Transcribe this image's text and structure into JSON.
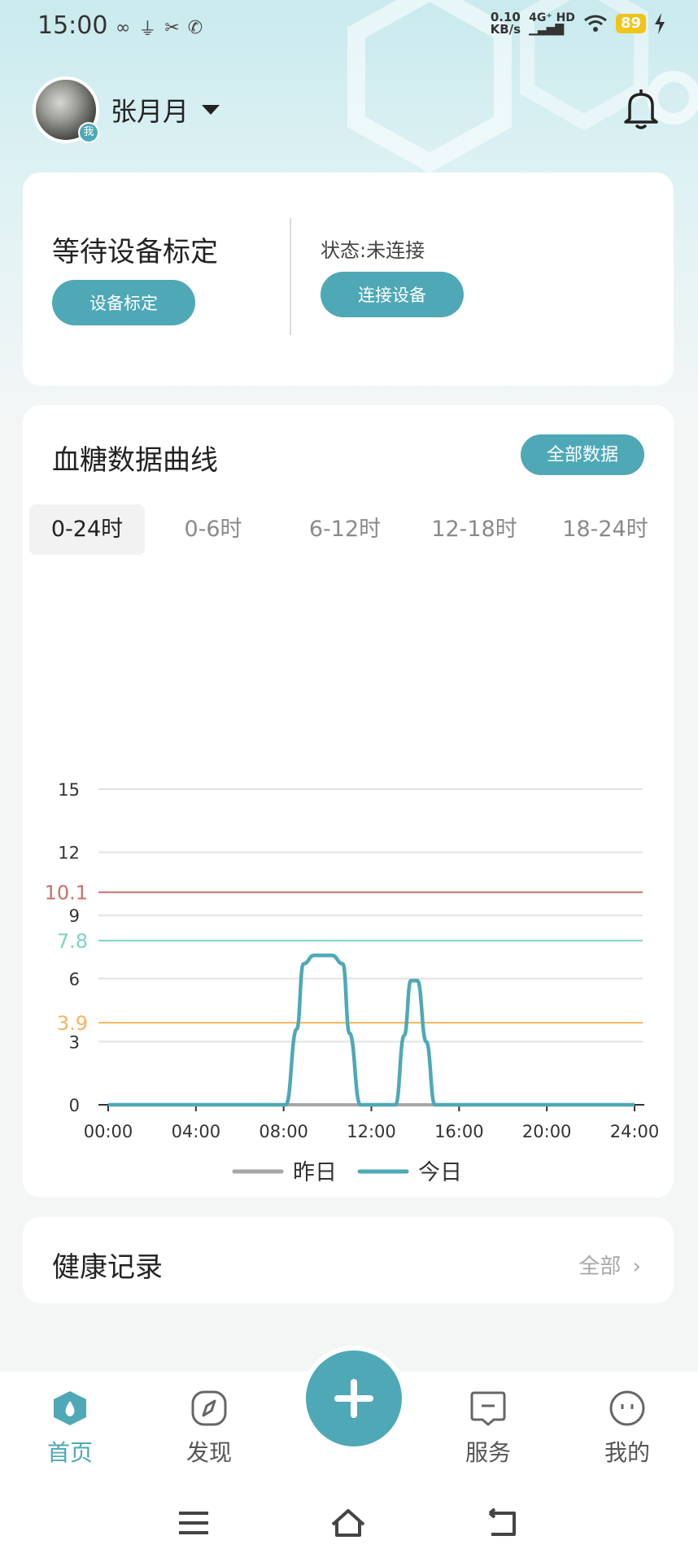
{
  "status_bar": {
    "time": "15:00",
    "net_speed_value": "0.10",
    "net_speed_unit": "KB/s",
    "network": "4G⁺ HD",
    "battery": "89",
    "icons": [
      "infinity-icon",
      "usb-icon",
      "tools-icon",
      "phone-icon",
      "signal-icon",
      "wifi-icon",
      "battery-icon",
      "charging-icon"
    ]
  },
  "user": {
    "name": "张月月",
    "badge": "我"
  },
  "device": {
    "calibration_title": "等待设备标定",
    "calibration_button": "设备标定",
    "status": "状态:未连接",
    "connect_button": "连接设备"
  },
  "chart_section": {
    "title": "血糖数据曲线",
    "all_data_button": "全部数据",
    "tabs": [
      "0-24时",
      "0-6时",
      "6-12时",
      "12-18时",
      "18-24时"
    ],
    "active_tab": "0-24时"
  },
  "chart_data": {
    "type": "line",
    "title": "",
    "xlabel": "",
    "ylabel": "",
    "x_ticks": [
      "00:00",
      "04:00",
      "08:00",
      "12:00",
      "16:00",
      "20:00",
      "24:00"
    ],
    "y_ticks": [
      0,
      3,
      6,
      9,
      12,
      15
    ],
    "ylim": [
      0,
      15
    ],
    "xlim": [
      0,
      24
    ],
    "reference_lines": [
      {
        "value": 10.1,
        "label": "10.1",
        "color": "#c9706a"
      },
      {
        "value": 7.8,
        "label": "7.8",
        "color": "#7dd3c0"
      },
      {
        "value": 3.9,
        "label": "3.9",
        "color": "#f5b45a"
      }
    ],
    "series": [
      {
        "name": "昨日",
        "color": "#a6a6a6",
        "x": [
          0,
          24
        ],
        "values": [
          0,
          0
        ]
      },
      {
        "name": "今日",
        "color": "#4fa8b6",
        "x": [
          0,
          8.1,
          8.6,
          8.9,
          9.4,
          10.2,
          10.7,
          11,
          11.5,
          13.1,
          13.5,
          13.8,
          14.1,
          14.5,
          14.9,
          24
        ],
        "values": [
          0,
          0,
          3.6,
          6.7,
          7.1,
          7.1,
          6.7,
          3.4,
          0,
          0,
          3.3,
          5.9,
          5.9,
          3.0,
          0,
          0
        ]
      }
    ],
    "legend_position": "bottom"
  },
  "health": {
    "title": "健康记录",
    "more": "全部"
  },
  "bottom_nav": {
    "items": [
      {
        "label": "首页",
        "icon": "home-drop-icon",
        "active": true
      },
      {
        "label": "发现",
        "icon": "compass-icon",
        "active": false
      },
      {
        "label": "服务",
        "icon": "message-icon",
        "active": false
      },
      {
        "label": "我的",
        "icon": "smile-icon",
        "active": false
      }
    ],
    "fab_icon": "plus-icon"
  },
  "colors": {
    "accent": "#4fa8b6",
    "danger_line": "#c9706a",
    "target_line": "#7dd3c0",
    "low_line": "#f5b45a"
  }
}
